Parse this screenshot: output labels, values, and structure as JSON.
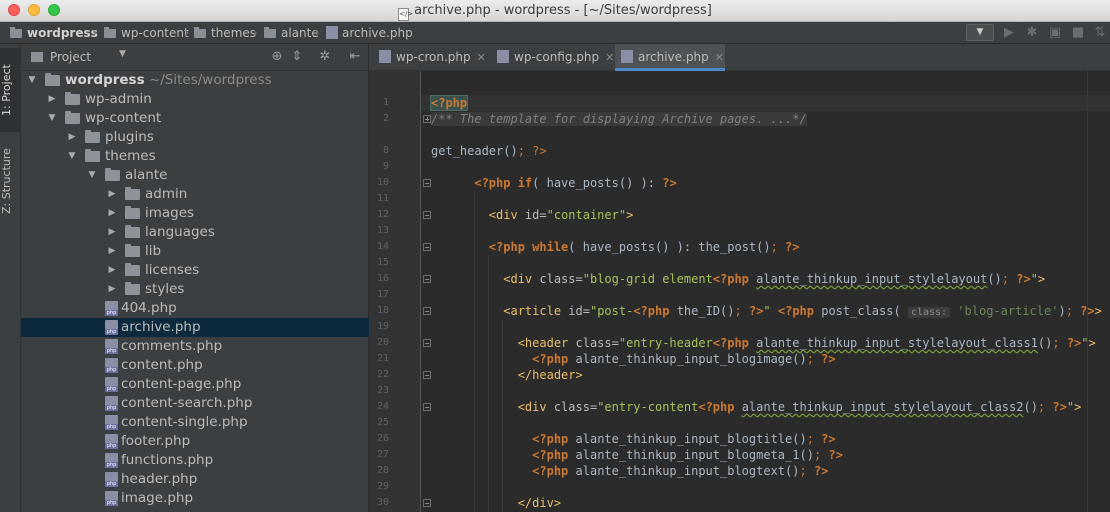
{
  "window": {
    "title": "archive.php - wordpress - [~/Sites/wordpress]"
  },
  "navbar": {
    "crumbs": [
      "wordpress",
      "wp-content",
      "themes",
      "alante",
      "archive.php"
    ]
  },
  "left_strip": {
    "project_tab": "1: Project",
    "structure_tab": "Z: Structure"
  },
  "project_panel": {
    "header_label": "Project",
    "tree": [
      {
        "label": "wordpress",
        "hint": "~/Sites/wordpress",
        "type": "folder",
        "depth": 0,
        "expanded": true
      },
      {
        "label": "wp-admin",
        "type": "folder",
        "depth": 1,
        "expanded": false
      },
      {
        "label": "wp-content",
        "type": "folder",
        "depth": 1,
        "expanded": true
      },
      {
        "label": "plugins",
        "type": "folder",
        "depth": 2,
        "expanded": false
      },
      {
        "label": "themes",
        "type": "folder",
        "depth": 2,
        "expanded": true
      },
      {
        "label": "alante",
        "type": "folder",
        "depth": 3,
        "expanded": true
      },
      {
        "label": "admin",
        "type": "folder",
        "depth": 4,
        "expanded": false
      },
      {
        "label": "images",
        "type": "folder",
        "depth": 4,
        "expanded": false
      },
      {
        "label": "languages",
        "type": "folder",
        "depth": 4,
        "expanded": false
      },
      {
        "label": "lib",
        "type": "folder",
        "depth": 4,
        "expanded": false
      },
      {
        "label": "licenses",
        "type": "folder",
        "depth": 4,
        "expanded": false
      },
      {
        "label": "styles",
        "type": "folder",
        "depth": 4,
        "expanded": false
      },
      {
        "label": "404.php",
        "type": "php",
        "depth": 4
      },
      {
        "label": "archive.php",
        "type": "php",
        "depth": 4,
        "selected": true
      },
      {
        "label": "comments.php",
        "type": "php",
        "depth": 4
      },
      {
        "label": "content.php",
        "type": "php",
        "depth": 4
      },
      {
        "label": "content-page.php",
        "type": "php",
        "depth": 4
      },
      {
        "label": "content-search.php",
        "type": "php",
        "depth": 4
      },
      {
        "label": "content-single.php",
        "type": "php",
        "depth": 4
      },
      {
        "label": "footer.php",
        "type": "php",
        "depth": 4
      },
      {
        "label": "functions.php",
        "type": "php",
        "depth": 4
      },
      {
        "label": "header.php",
        "type": "php",
        "depth": 4
      },
      {
        "label": "image.php",
        "type": "php",
        "depth": 4
      }
    ]
  },
  "tabs": [
    {
      "label": "wp-cron.php",
      "active": false
    },
    {
      "label": "wp-config.php",
      "active": false
    },
    {
      "label": "archive.php",
      "active": true
    }
  ],
  "editor": {
    "line_numbers": [
      "1",
      "2",
      "8",
      "9",
      "10",
      "11",
      "12",
      "13",
      "14",
      "15",
      "16",
      "17",
      "18",
      "19",
      "20",
      "21",
      "22",
      "23",
      "24",
      "25",
      "26",
      "27",
      "28",
      "29",
      "30"
    ],
    "lines": {
      "l1": "<?php",
      "l2": "/** The template for displaying Archive pages. ...*/",
      "l8_fn": "get_header",
      "l10_fn": "have_posts",
      "l12_id": "\"container\"",
      "l14_fn1": "have_posts",
      "l14_fn2": "the_post",
      "l16_class": "\"blog-grid element",
      "l16_fn": "alante_thinkup_input_stylelayout",
      "l18_id": "\"post-",
      "l18_fn1": "the_ID",
      "l18_fn2": "post_class",
      "l18_hint": "class:",
      "l18_str": "'blog-article'",
      "l20_class": "\"entry-header",
      "l20_fn": "alante_thinkup_input_stylelayout_class1",
      "l21_fn": "alante_thinkup_input_blogimage",
      "l24_class": "\"entry-content",
      "l24_fn": "alante_thinkup_input_stylelayout_class2",
      "l26_fn": "alante_thinkup_input_blogtitle",
      "l27_fn": "alante_thinkup_input_blogmeta_1",
      "l28_fn": "alante_thinkup_input_blogtext"
    }
  }
}
